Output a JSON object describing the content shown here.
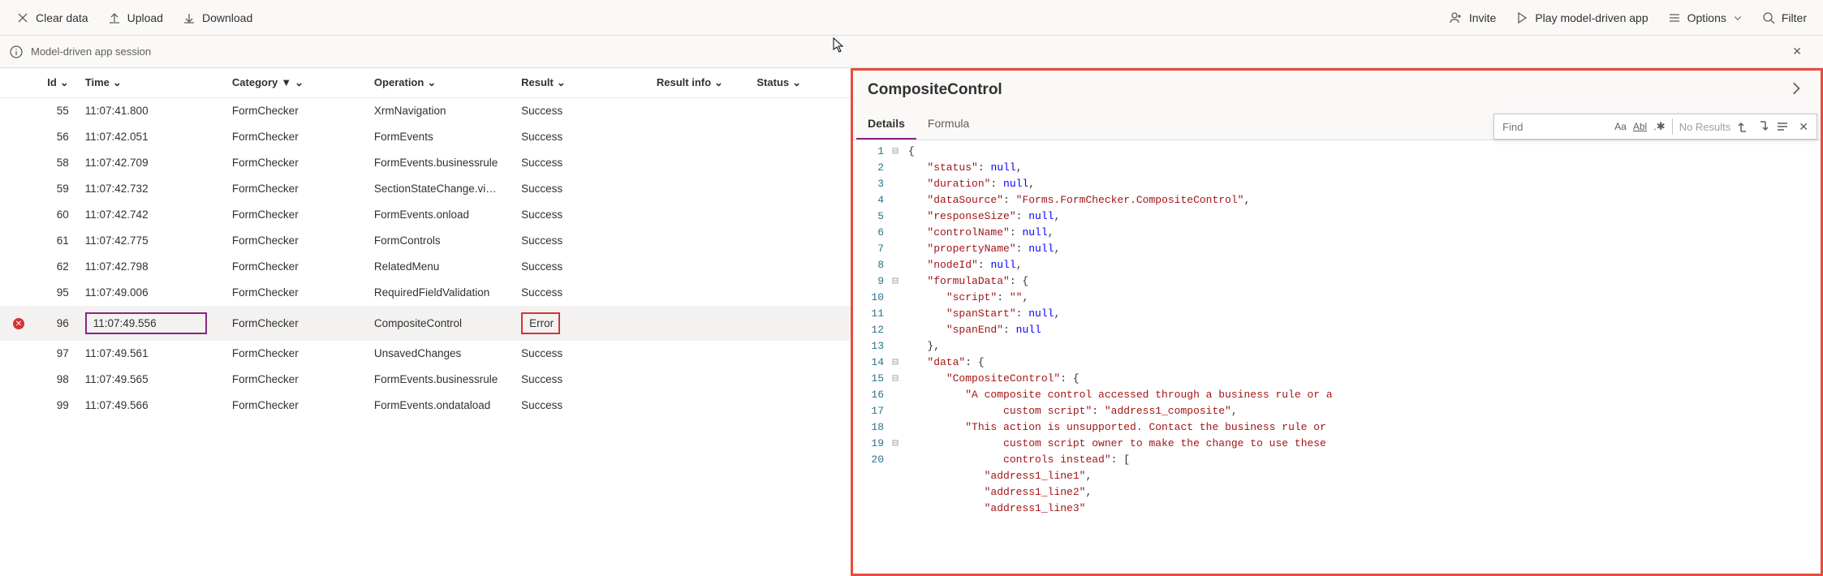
{
  "toolbar": {
    "clear": "Clear data",
    "upload": "Upload",
    "download": "Download",
    "invite": "Invite",
    "play": "Play model-driven app",
    "options": "Options",
    "filter": "Filter"
  },
  "session": {
    "label": "Model-driven app session"
  },
  "columns": {
    "id": "Id",
    "time": "Time",
    "category": "Category",
    "operation": "Operation",
    "result": "Result",
    "info": "Result info",
    "status": "Status"
  },
  "rows": [
    {
      "id": "55",
      "time": "11:07:41.800",
      "cat": "FormChecker",
      "op": "XrmNavigation",
      "res": "Success"
    },
    {
      "id": "56",
      "time": "11:07:42.051",
      "cat": "FormChecker",
      "op": "FormEvents",
      "res": "Success"
    },
    {
      "id": "58",
      "time": "11:07:42.709",
      "cat": "FormChecker",
      "op": "FormEvents.businessrule",
      "res": "Success"
    },
    {
      "id": "59",
      "time": "11:07:42.732",
      "cat": "FormChecker",
      "op": "SectionStateChange.vi…",
      "res": "Success"
    },
    {
      "id": "60",
      "time": "11:07:42.742",
      "cat": "FormChecker",
      "op": "FormEvents.onload",
      "res": "Success"
    },
    {
      "id": "61",
      "time": "11:07:42.775",
      "cat": "FormChecker",
      "op": "FormControls",
      "res": "Success"
    },
    {
      "id": "62",
      "time": "11:07:42.798",
      "cat": "FormChecker",
      "op": "RelatedMenu",
      "res": "Success"
    },
    {
      "id": "95",
      "time": "11:07:49.006",
      "cat": "FormChecker",
      "op": "RequiredFieldValidation",
      "res": "Success"
    },
    {
      "id": "96",
      "time": "11:07:49.556",
      "cat": "FormChecker",
      "op": "CompositeControl",
      "res": "Error",
      "err": true,
      "sel": true
    },
    {
      "id": "97",
      "time": "11:07:49.561",
      "cat": "FormChecker",
      "op": "UnsavedChanges",
      "res": "Success"
    },
    {
      "id": "98",
      "time": "11:07:49.565",
      "cat": "FormChecker",
      "op": "FormEvents.businessrule",
      "res": "Success"
    },
    {
      "id": "99",
      "time": "11:07:49.566",
      "cat": "FormChecker",
      "op": "FormEvents.ondataload",
      "res": "Success"
    }
  ],
  "panel": {
    "title": "CompositeControl",
    "tabs": {
      "details": "Details",
      "formula": "Formula"
    },
    "find_placeholder": "Find",
    "no_results": "No Results"
  },
  "code_lines": [
    "1",
    "2",
    "3",
    "4",
    "5",
    "6",
    "7",
    "8",
    "9",
    "10",
    "11",
    "12",
    "13",
    "14",
    "15",
    "16",
    "17",
    "18",
    "19",
    "20"
  ],
  "fold": [
    "⊟",
    "",
    "",
    "",
    "",
    "",
    "",
    "",
    "⊟",
    "",
    "",
    "",
    "",
    "⊟",
    "⊟",
    "",
    "",
    "",
    "⊟",
    ""
  ],
  "json_detail": {
    "l1": "{",
    "l2a": "\"status\"",
    "l2b": ": ",
    "l2c": "null",
    "l2d": ",",
    "l3a": "\"duration\"",
    "l3c": "null",
    "l4a": "\"dataSource\"",
    "l4c": "\"Forms.FormChecker.CompositeControl\"",
    "l5a": "\"responseSize\"",
    "l5c": "null",
    "l6a": "\"controlName\"",
    "l6c": "null",
    "l7a": "\"propertyName\"",
    "l7c": "null",
    "l8a": "\"nodeId\"",
    "l8c": "null",
    "l9a": "\"formulaData\"",
    "l9c": "{",
    "l10a": "\"script\"",
    "l10c": "\"\"",
    "l11a": "\"spanStart\"",
    "l11c": "null",
    "l12a": "\"spanEnd\"",
    "l12c": "null",
    "l13": "},",
    "l14a": "\"data\"",
    "l14c": "{",
    "l15a": "\"CompositeControl\"",
    "l15c": "{",
    "l16a": "\"A composite control accessed through a business rule or a",
    "l16b": "custom script\"",
    "l16c": "\"address1_composite\"",
    "l17a": "\"This action is unsupported. Contact the business rule or",
    "l17b": "custom script owner to make the change to use these",
    "l17c": "controls instead\"",
    "l17d": "[",
    "l18": "\"address1_line1\"",
    "l19": "\"address1_line2\"",
    "l20": "\"address1_line3\""
  }
}
